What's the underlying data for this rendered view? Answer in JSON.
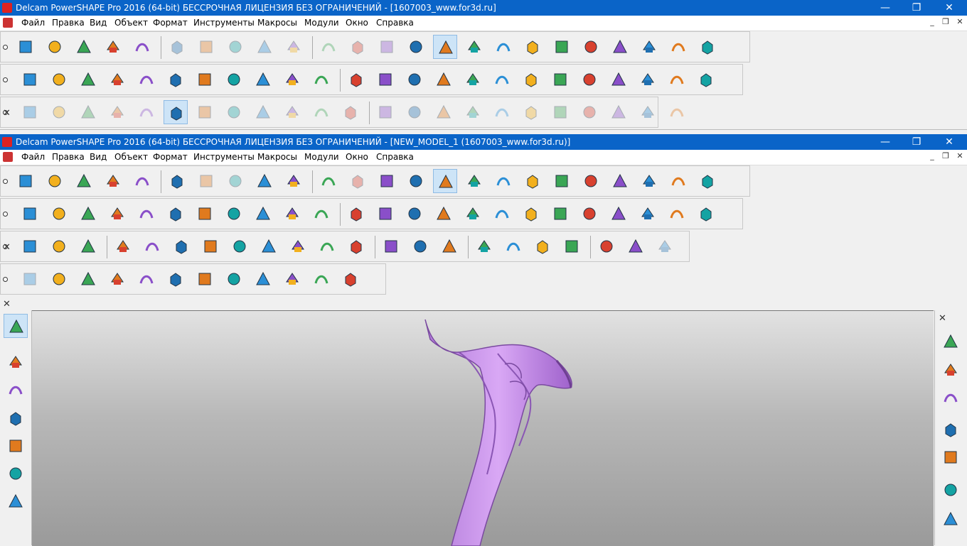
{
  "windows": [
    {
      "title": "Delcam PowerSHAPE Pro 2016 (64-bit) БЕССРОЧНАЯ ЛИЦЕНЗИЯ БЕЗ ОГРАНИЧЕНИЙ - [1607003_www.for3d.ru]",
      "menu": [
        "Файл",
        "Правка",
        "Вид",
        "Объект",
        "Формат",
        "Инструменты",
        "Макросы",
        "Модули",
        "Окно",
        "Справка"
      ]
    },
    {
      "title": "Delcam PowerSHAPE Pro 2016 (64-bit) БЕССРОЧНАЯ ЛИЦЕНЗИЯ БЕЗ ОГРАНИЧЕНИЙ - [NEW_MODEL_1 (1607003_www.for3d.ru)]",
      "menu": [
        "Файл",
        "Правка",
        "Вид",
        "Объект",
        "Формат",
        "Инструменты",
        "Макросы",
        "Модули",
        "Окно",
        "Справка"
      ]
    }
  ],
  "window_controls": {
    "minimize": "—",
    "maximize": "❐",
    "close": "✕"
  },
  "mdi_controls": {
    "minimize": "_",
    "restore": "❐",
    "close": "✕"
  },
  "toolbars": {
    "main_icons": [
      "new-file-icon",
      "open-folder-icon",
      "import-icon",
      "save-icon",
      "print-icon",
      "cut-icon",
      "copy-icon",
      "paste-icon",
      "erase-icon",
      "delete-icon",
      "undo-icon",
      "redo-icon",
      "edit-pencil-icon",
      "workplane-icon",
      "axis-icon",
      "line-icon",
      "circle-icon",
      "arc-icon",
      "text-icon",
      "surface-icon",
      "solid-icon",
      "lamina-icon",
      "tools-gear-icon",
      "wizard-icon"
    ],
    "second_icons": [
      "warning-icon",
      "paint-icon",
      "layout-icon",
      "connect-icon",
      "transform-icon",
      "move-icon",
      "rotate-icon",
      "cubes-icon",
      "measure-icon",
      "box-icon",
      "medical-cross-icon",
      "calculator-icon",
      "info-icon",
      "colour-icon",
      "shading-icon",
      "stripes-icon",
      "red-green-icon",
      "gradient-icon",
      "teal-tri-icon",
      "stack-icon",
      "frame-icon",
      "help-icon",
      "zoom-doc-icon",
      "rainbow-icon"
    ],
    "curves_icons": [
      "curve-edit-icon",
      "curve-1-icon",
      "curve-2-icon",
      "curve-3-icon",
      "curve-4-icon",
      "curve-5-icon",
      "curve-6-icon",
      "curve-7-icon",
      "curve-8-icon",
      "curve-9-icon",
      "curve-10-icon",
      "curve-11-icon",
      "curve-12-icon",
      "curve-13-icon",
      "curve-14-icon",
      "curve-15-icon",
      "curve-16-icon",
      "curve-17-icon",
      "curve-18-icon",
      "curve-19-icon",
      "curve-20-icon",
      "curve-21-icon",
      "curve-22-icon"
    ],
    "solid_icons": [
      "select-box-icon",
      "layers-icon",
      "cylinder-icon",
      "pyramid-icon",
      "extrude-icon",
      "cut-solid-icon",
      "merge-icon",
      "stairs-icon",
      "slice-icon",
      "sphere-icon",
      "fillet-icon",
      "cone-icon",
      "arrow-solid-icon",
      "arrow-red-icon",
      "add-feature-icon",
      "bubbles-icon",
      "edit-face-icon",
      "red-pyramid-icon",
      "z-icon",
      "tree-icon",
      "star-icon",
      "diamond-icon"
    ],
    "feature_icons": [
      "block-icon",
      "xy-icon",
      "import-solid-icon",
      "rotate-solid-icon",
      "split-icon",
      "cube-wire-icon",
      "multi-cube-icon",
      "grid-cubes-icon",
      "wave-icon",
      "arrows-down-icon",
      "sphere2-icon",
      "blue-arrow-icon"
    ]
  },
  "left_tools": [
    "select-arrow-icon",
    "workplane-axis-icon",
    "workplane-multi-icon",
    "globe-icon",
    "plane-icon",
    "dynamic-axis-icon",
    "crosshair-icon"
  ],
  "right_tools": [
    "view-iso-icon",
    "view-top-icon",
    "view-front-icon",
    "shaded-cube-icon",
    "views-icon",
    "undo-view-icon",
    "zoom-history-icon"
  ],
  "close_glyph": "✕"
}
